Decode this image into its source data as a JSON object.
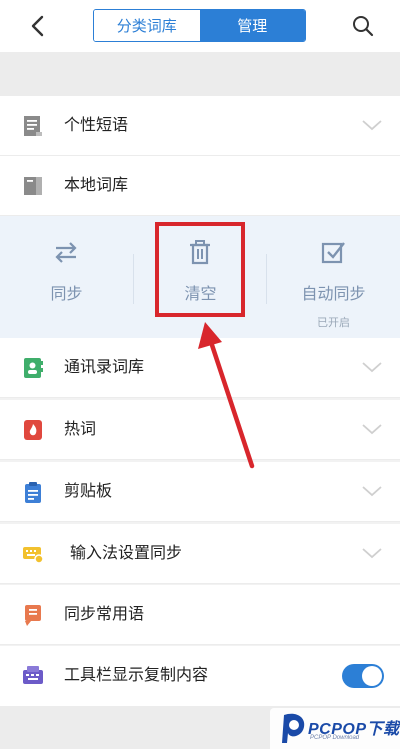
{
  "header": {
    "tabs": [
      {
        "label": "分类词库",
        "active": false
      },
      {
        "label": "管理",
        "active": true
      }
    ],
    "accent_color": "#2c7fd6"
  },
  "rows_top": [
    {
      "label": "个性短语",
      "icon": "document-lines-icon",
      "expandable": true
    },
    {
      "label": "本地词库",
      "icon": "local-book-icon",
      "expandable": false
    }
  ],
  "actions": [
    {
      "label": "同步",
      "icon": "sync-arrows-icon",
      "sub": ""
    },
    {
      "label": "清空",
      "icon": "trash-icon",
      "sub": "",
      "highlighted": true
    },
    {
      "label": "自动同步",
      "icon": "checkbox-icon",
      "sub": "已开启"
    }
  ],
  "rows_bottom": [
    {
      "label": "通讯录词库",
      "icon": "contacts-book-icon",
      "expandable": true
    },
    {
      "label": "热词",
      "icon": "flame-icon",
      "expandable": true
    },
    {
      "label": "剪贴板",
      "icon": "clipboard-icon",
      "expandable": true
    },
    {
      "label": "输入法设置同步",
      "icon": "keyboard-sync-icon",
      "expandable": true
    },
    {
      "label": "同步常用语",
      "icon": "phrases-icon",
      "expandable": false
    },
    {
      "label": "工具栏显示复制内容",
      "icon": "toolbar-copy-icon",
      "expandable": false,
      "toggle": true
    }
  ],
  "watermark": {
    "brand": "PCPOP下载",
    "sub": "PCPOP Download"
  },
  "highlight_color": "#d8262c"
}
